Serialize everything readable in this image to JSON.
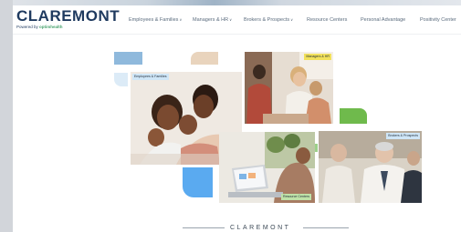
{
  "brand": {
    "name": "CLAREMONT",
    "powered_by": "Powered by",
    "partner": "optimhealth"
  },
  "nav": {
    "items": [
      {
        "label": "Employees & Families",
        "dropdown": true
      },
      {
        "label": "Managers & HR",
        "dropdown": true
      },
      {
        "label": "Brokers & Prospects",
        "dropdown": true
      },
      {
        "label": "Resource Centers",
        "dropdown": false
      },
      {
        "label": "Personal Advantage",
        "dropdown": false
      },
      {
        "label": "Positivity Center",
        "dropdown": false
      }
    ],
    "caret": "∨"
  },
  "tiles": {
    "employees": "Employees & Families",
    "managers": "Managers & HR",
    "resources": "Resource Centers",
    "brokers": "Brokers & Prospects"
  },
  "footer": {
    "wordmark": "CLAREMONT"
  },
  "colors": {
    "navy": "#1f3a5f",
    "green": "#49a36e",
    "blue_accent": "#5aaaf0",
    "tan_accent": "#e9d4bd",
    "green_accent": "#6fba4c",
    "yellow_tag": "#f2e15c",
    "light_blue_tag": "#cfe6f7",
    "green_tag": "#bfe2a8"
  }
}
